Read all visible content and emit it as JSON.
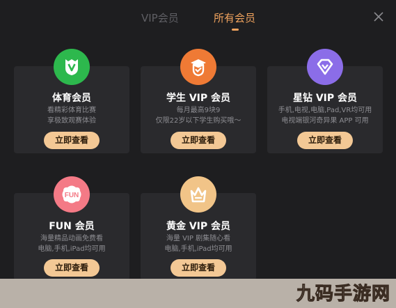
{
  "tabs": {
    "vip": "VIP会员",
    "all": "所有会员"
  },
  "colors": {
    "accent": "#f0a35e",
    "button_bg": "#f3c895",
    "card_bg": "#2a2a2d"
  },
  "cards": [
    {
      "title": "体育会员",
      "desc1": "看精彩体育比赛",
      "desc2": "享极致观赛体验",
      "button": "立即查看",
      "icon": "sports-crest-icon",
      "icon_color": "#2db84d"
    },
    {
      "title": "学生 VIP 会员",
      "desc1": "每月最高9块9",
      "desc2": "仅限22岁以下学生购买哦～",
      "button": "立即查看",
      "icon": "student-shield-icon",
      "icon_color": "#ef7a35"
    },
    {
      "title": "星钻 VIP 会员",
      "desc1": "手机,电视,电脑,Pad,VR均可用",
      "desc2": "电视端银河奇异果 APP 可用",
      "button": "立即查看",
      "icon": "diamond-icon",
      "icon_color": "#8b6de8"
    },
    {
      "title": "FUN 会员",
      "desc1": "海量精品动画免费看",
      "desc2": "电脑,手机,iPad均可用",
      "button": "立即查看",
      "icon": "fun-badge-icon",
      "icon_color": "#f47a86"
    },
    {
      "title": "黄金 VIP 会员",
      "desc1": "海量 VIP 剧集随心看",
      "desc2": "电脑,手机,iPad均可用",
      "button": "立即查看",
      "icon": "gold-crown-icon",
      "icon_color": "#f1c488"
    }
  ],
  "watermark": "九码手游网"
}
